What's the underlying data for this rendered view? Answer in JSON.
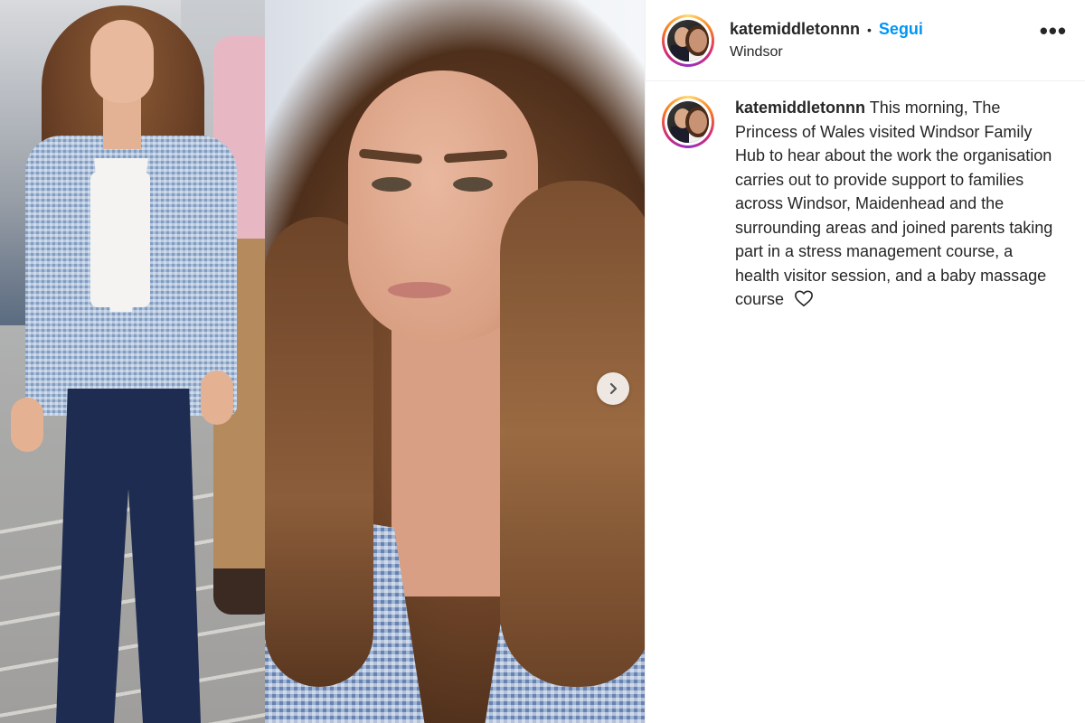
{
  "post": {
    "username": "katemiddletonnn",
    "separator": "•",
    "follow_label": "Segui",
    "location": "Windsor",
    "more_label": "•••"
  },
  "caption": {
    "username": "katemiddletonnn",
    "text": "This morning, The Princess of Wales visited Windsor Family Hub to hear about the work the organisation carries out to provide support to families across Windsor, Maidenhead and the surrounding areas and joined parents taking part in a stress management course, a health visitor session, and a baby massage course",
    "emoji_icon": "heart-outline-icon"
  },
  "media": {
    "next_icon": "chevron-right-icon"
  },
  "colors": {
    "follow": "#0095f6",
    "text": "#262626",
    "divider": "#efefef"
  }
}
